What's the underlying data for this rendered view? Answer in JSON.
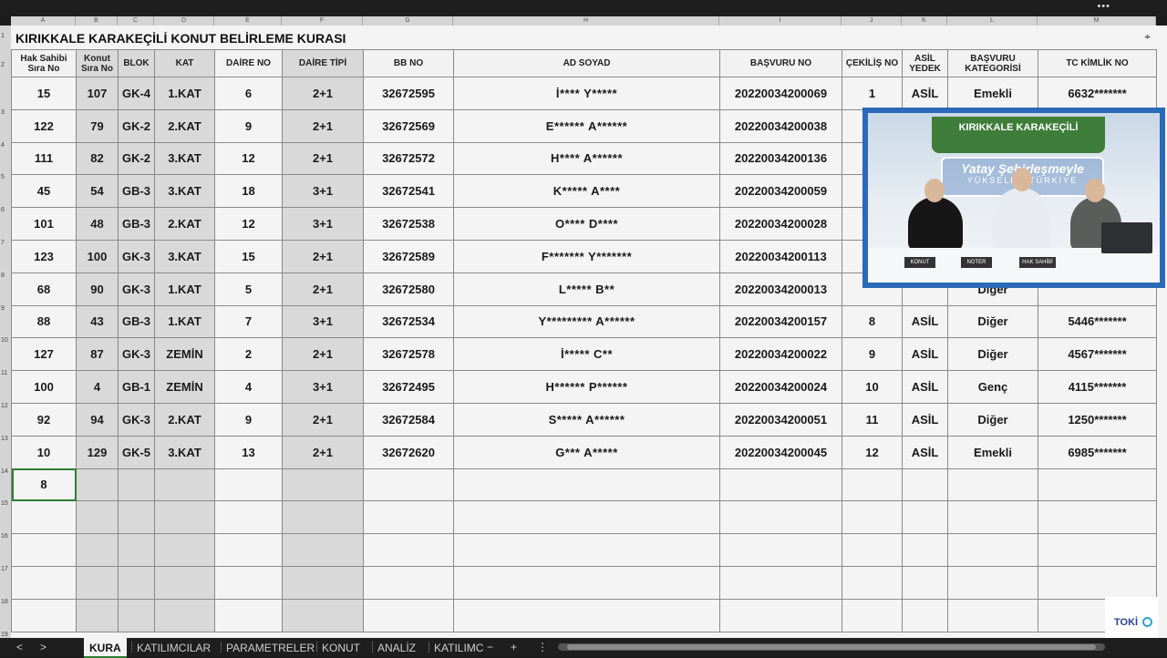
{
  "title": "KIRIKKALE KARAKEÇİLİ KONUT BELİRLEME KURASI",
  "column_letters": [
    "A",
    "B",
    "C",
    "D",
    "E",
    "F",
    "G",
    "H",
    "I",
    "J",
    "K",
    "L",
    "M"
  ],
  "row_numbers": [
    "1",
    "2",
    "3",
    "4",
    "5",
    "6",
    "7",
    "8",
    "9",
    "10",
    "11",
    "12",
    "13",
    "14",
    "15",
    "16",
    "17",
    "18",
    "19"
  ],
  "headers": [
    "Hak Sahibi Sıra No",
    "Konut Sıra No",
    "BLOK",
    "KAT",
    "DAİRE NO",
    "DAİRE TİPİ",
    "BB NO",
    "AD SOYAD",
    "BAŞVURU NO",
    "ÇEKİLİŞ NO",
    "ASİL YEDEK",
    "BAŞVURU KATEGORİSİ",
    "TC KİMLİK NO"
  ],
  "rows": [
    [
      "15",
      "107",
      "GK-4",
      "1.KAT",
      "6",
      "2+1",
      "32672595",
      "İ**** Y*****",
      "20220034200069",
      "1",
      "ASİL",
      "Emekli",
      "6632*******"
    ],
    [
      "122",
      "79",
      "GK-2",
      "2.KAT",
      "9",
      "2+1",
      "32672569",
      "E****** A******",
      "20220034200038",
      "",
      "",
      "",
      ""
    ],
    [
      "111",
      "82",
      "GK-2",
      "3.KAT",
      "12",
      "2+1",
      "32672572",
      "H**** A******",
      "20220034200136",
      "",
      "",
      "",
      ""
    ],
    [
      "45",
      "54",
      "GB-3",
      "3.KAT",
      "18",
      "3+1",
      "32672541",
      "K***** A****",
      "20220034200059",
      "",
      "",
      "",
      ""
    ],
    [
      "101",
      "48",
      "GB-3",
      "2.KAT",
      "12",
      "3+1",
      "32672538",
      "O**** D****",
      "20220034200028",
      "",
      "",
      "",
      ""
    ],
    [
      "123",
      "100",
      "GK-3",
      "3.KAT",
      "15",
      "2+1",
      "32672589",
      "F******* Y*******",
      "20220034200113",
      "",
      "",
      "",
      ""
    ],
    [
      "68",
      "90",
      "GK-3",
      "1.KAT",
      "5",
      "2+1",
      "32672580",
      "L***** B**",
      "20220034200013",
      "",
      "",
      "Diğer",
      ""
    ],
    [
      "88",
      "43",
      "GB-3",
      "1.KAT",
      "7",
      "3+1",
      "32672534",
      "Y********* A******",
      "20220034200157",
      "8",
      "ASİL",
      "Diğer",
      "5446*******"
    ],
    [
      "127",
      "87",
      "GK-3",
      "ZEMİN",
      "2",
      "2+1",
      "32672578",
      "İ***** C**",
      "20220034200022",
      "9",
      "ASİL",
      "Diğer",
      "4567*******"
    ],
    [
      "100",
      "4",
      "GB-1",
      "ZEMİN",
      "4",
      "3+1",
      "32672495",
      "H****** P******",
      "20220034200024",
      "10",
      "ASİL",
      "Genç",
      "4115*******"
    ],
    [
      "92",
      "94",
      "GK-3",
      "2.KAT",
      "9",
      "2+1",
      "32672584",
      "S***** A******",
      "20220034200051",
      "11",
      "ASİL",
      "Diğer",
      "1250*******"
    ],
    [
      "10",
      "129",
      "GK-5",
      "3.KAT",
      "13",
      "2+1",
      "32672620",
      "G*** A*****",
      "20220034200045",
      "12",
      "ASİL",
      "Emekli",
      "6985*******"
    ],
    [
      "8",
      "",
      "",
      "",
      "",
      "",
      "",
      "",
      "",
      "",
      "",
      "",
      ""
    ],
    [
      "",
      "",
      "",
      "",
      "",
      "",
      "",
      "",
      "",
      "",
      "",
      "",
      ""
    ],
    [
      "",
      "",
      "",
      "",
      "",
      "",
      "",
      "",
      "",
      "",
      "",
      "",
      ""
    ],
    [
      "",
      "",
      "",
      "",
      "",
      "",
      "",
      "",
      "",
      "",
      "",
      "",
      ""
    ],
    [
      "",
      "",
      "",
      "",
      "",
      "",
      "",
      "",
      "",
      "",
      "",
      "",
      ""
    ]
  ],
  "tabs": [
    "KURA",
    "KATILIMCILAR",
    "PARAMETRELER",
    "KONUT",
    "ANALİZ",
    "KATILIMC"
  ],
  "active_tab": "KURA",
  "nav": {
    "prev": "<",
    "next": ">",
    "add": "+",
    "more": "⋮",
    "minus": "−"
  },
  "window_dots": "•••",
  "video": {
    "banner": "KIRIKKALE KARAKEÇİLİ",
    "slogan_line1": "Yatay Şehirleşmeyle",
    "slogan_line2": "YÜKSELEN TÜRKİYE",
    "cards": [
      "KONUT",
      "NOTER",
      "HAK SAHİBİ"
    ]
  },
  "logo": "TOKİ",
  "colors": {
    "asil": "#5aa936",
    "selection": "#2e7d32",
    "pip_border": "#2a6ab8"
  }
}
